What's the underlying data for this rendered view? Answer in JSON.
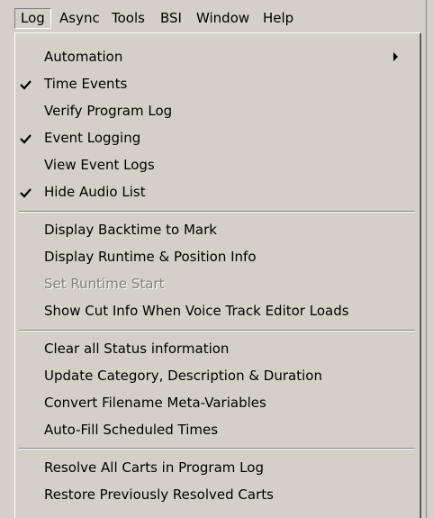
{
  "menubar": {
    "items": [
      {
        "label": "Log",
        "open": true
      },
      {
        "label": "Async"
      },
      {
        "label": "Tools"
      },
      {
        "label": "BSI"
      },
      {
        "label": "Window"
      },
      {
        "label": "Help"
      }
    ]
  },
  "log_menu": {
    "items": [
      {
        "label": "Automation",
        "has_submenu": true,
        "submenu_icon": "chevron-right-icon"
      },
      {
        "label": "Time Events",
        "checked": true,
        "check_icon": "checkmark-icon"
      },
      {
        "label": "Verify Program Log"
      },
      {
        "label": "Event Logging",
        "checked": true,
        "check_icon": "checkmark-icon"
      },
      {
        "label": "View Event Logs"
      },
      {
        "label": "Hide Audio List",
        "checked": true,
        "check_icon": "checkmark-icon"
      },
      {
        "label": "Display Backtime to Mark"
      },
      {
        "label": "Display Runtime & Position Info"
      },
      {
        "label": "Set Runtime Start",
        "disabled": true
      },
      {
        "label": "Show Cut Info When Voice Track Editor Loads"
      },
      {
        "label": "Clear all Status information"
      },
      {
        "label": "Update Category, Description & Duration"
      },
      {
        "label": "Convert Filename Meta-Variables"
      },
      {
        "label": "Auto-Fill Scheduled Times"
      },
      {
        "label": "Resolve All Carts in Program Log"
      },
      {
        "label": "Restore Previously Resolved Carts"
      }
    ]
  },
  "colors": {
    "menu_background": "#d4d0c8",
    "disabled_text": "#808080",
    "text": "#000000"
  }
}
